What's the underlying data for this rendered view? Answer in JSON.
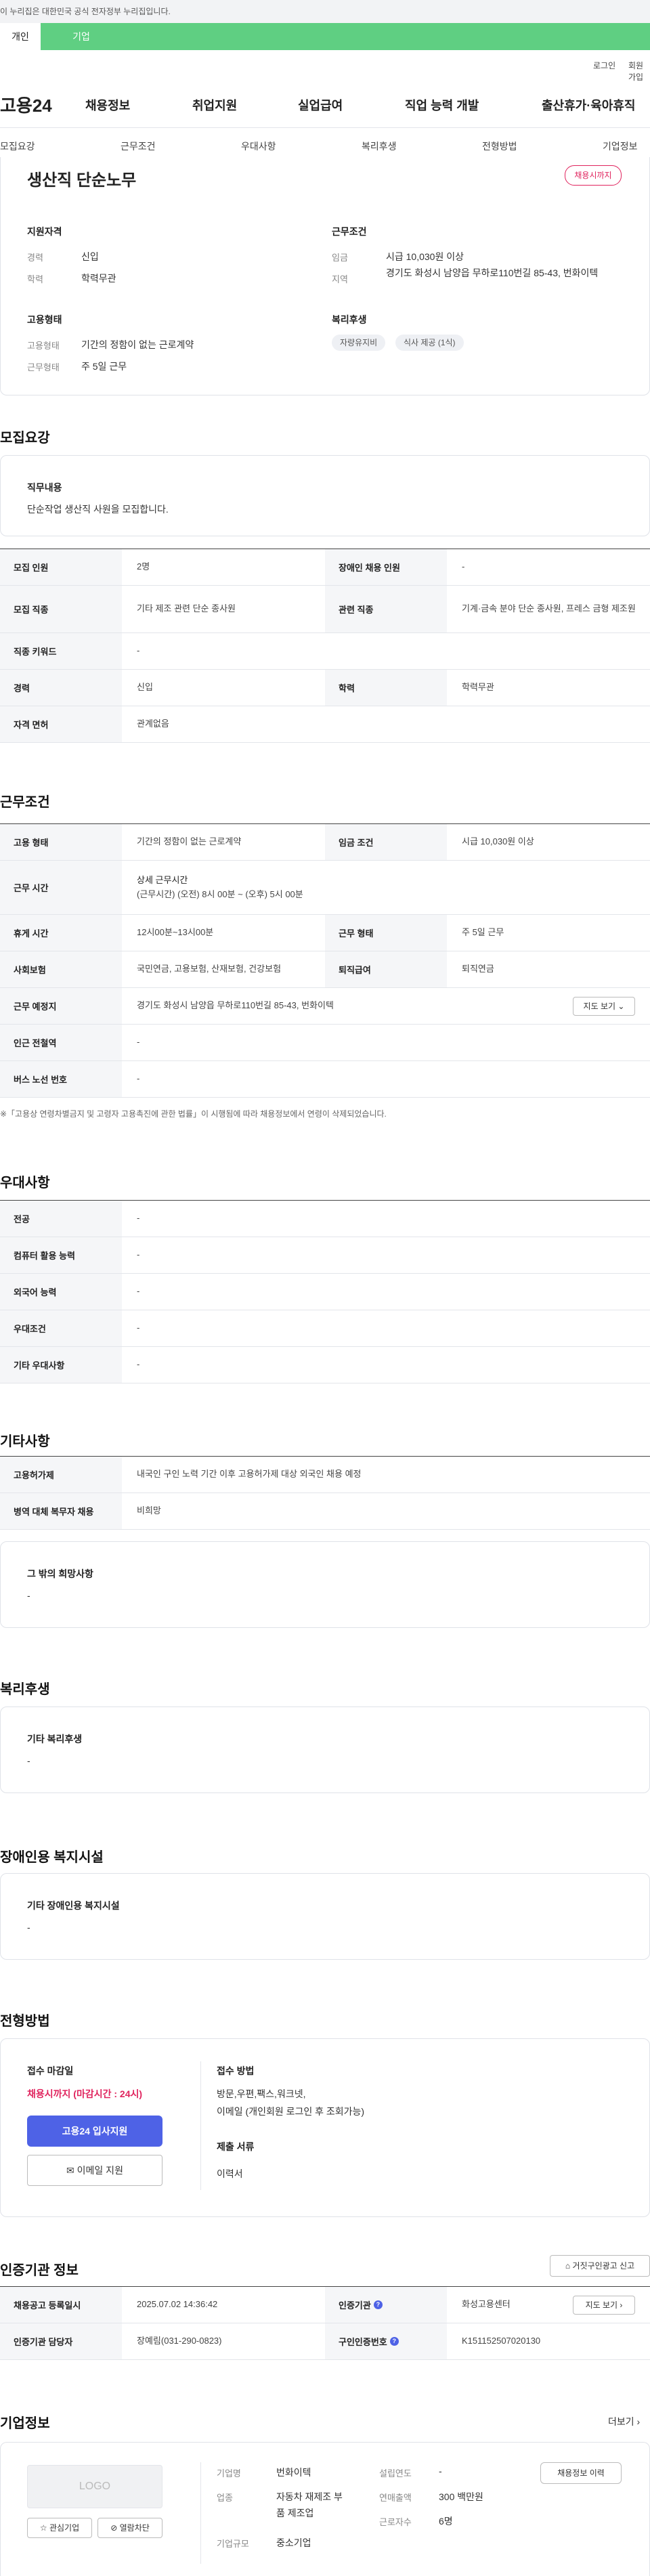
{
  "banner": {
    "text": "이 누리집은 대한민국 공식 전자정부 누리집입니다."
  },
  "tabs": {
    "individual": "개인",
    "company": "기업"
  },
  "util": {
    "login": "로그인",
    "join": "회원가입"
  },
  "logo": "고용24",
  "gnb": [
    "채용정보",
    "취업지원",
    "실업급여",
    "직업 능력 개발",
    "출산휴가·육아휴직"
  ],
  "subnav": [
    "모집요강",
    "근무조건",
    "우대사항",
    "복리후생",
    "전형방법",
    "기업정보"
  ],
  "summary": {
    "title": "생산직 단순노무",
    "badge": "채용시까지",
    "qual_heading": "지원자격",
    "career_label": "경력",
    "career_value": "신입",
    "edu_label": "학력",
    "edu_value": "학력무관",
    "emp_heading": "고용형태",
    "emptype_label": "고용형태",
    "emptype_value": "기간의 정함이 없는 근로계약",
    "worktype_label": "근무형태",
    "worktype_value": "주 5일 근무",
    "cond_heading": "근무조건",
    "wage_label": "임금",
    "wage_value": "시급 10,030원 이상",
    "region_label": "지역",
    "region_value": "경기도 화성시 남양읍 무하로110번길 85-43, 번화이텍",
    "welfare_heading": "복리후생",
    "chips": [
      "자량유지비",
      "식사 제공 (1식)"
    ]
  },
  "recruit": {
    "title": "모집요강",
    "duty_heading": "직무내용",
    "duty_text": "단순작업 생산직 사원을 모집합니다.",
    "rows": [
      {
        "k1": "모집 인원",
        "v1": "2명",
        "k2": "장애인 채용 인원",
        "v2": "-"
      },
      {
        "k1": "모집 직종",
        "v1": "기타 제조 관련 단순 종사원",
        "k2": "관련 직종",
        "v2": "기계·금속 분야 단순 종사원, 프레스 금형 제조원"
      },
      {
        "k1": "직종 키워드",
        "v1": "-"
      },
      {
        "k1": "경력",
        "v1": "신입",
        "k2": "학력",
        "v2": "학력무관"
      },
      {
        "k1": "자격 면허",
        "v1": "관계없음"
      }
    ]
  },
  "work": {
    "title": "근무조건",
    "emptype_k": "고용 형태",
    "emptype_v": "기간의 정함이 없는 근로계약",
    "wage_k": "임금 조건",
    "wage_v": "시급 10,030원 이상",
    "hours_k": "근무 시간",
    "hours_v1": "상세 근무시간",
    "hours_v2": "(근무시간) (오전) 8시 00분 ~ (오후) 5시 00분",
    "break_k": "휴게 시간",
    "break_v": "12시00분~13시00분",
    "form_k": "근무 형태",
    "form_v": "주 5일 근무",
    "ins_k": "사회보험",
    "ins_v": "국민연금, 고용보험, 산재보험, 건강보험",
    "sev_k": "퇴직급여",
    "sev_v": "퇴직연금",
    "place_k": "근무 예정지",
    "place_v": "경기도 화성시 남양읍 무하로110번길 85-43, 번화이텍",
    "map_btn": "지도 보기",
    "subway_k": "인근 전철역",
    "subway_v": "-",
    "bus_k": "버스 노선 번호",
    "bus_v": "-",
    "note": "※「고용상 연령차별금지 및 고령자 고용촉진에 관한 법률」이 시행됨에 따라 채용정보에서 연령이 삭제되었습니다."
  },
  "pref": {
    "title": "우대사항",
    "rows": [
      [
        "전공",
        "-"
      ],
      [
        "컴퓨터 활용 능력",
        "-"
      ],
      [
        "외국어 능력",
        "-"
      ],
      [
        "우대조건",
        "-"
      ],
      [
        "기타 우대사항",
        "-"
      ]
    ]
  },
  "etc": {
    "title": "기타사항",
    "permit_k": "고용허가제",
    "permit_v": "내국인 구인 노력 기간 이후 고용허가제 대상 외국인 채용 예정",
    "mil_k": "병역 대체 복무자 채용",
    "mil_v": "비희망",
    "other_heading": "그 밖의 희망사항",
    "other_v": "-"
  },
  "welfare": {
    "title": "복리후생",
    "heading": "기타 복리후생",
    "value": "-"
  },
  "disabled": {
    "title": "장애인용 복지시설",
    "heading": "기타 장애인용 복지시설",
    "value": "-"
  },
  "process": {
    "title": "전형방법",
    "deadline_heading": "접수 마감일",
    "deadline_value": "채용시까지 (마감시간 : 24시)",
    "apply_btn": "고용24 입사지원",
    "email_btn": "이메일 지원",
    "method_heading": "접수 방법",
    "method_value1": "방문,우편,팩스,워크넷,",
    "method_value2": "이메일 (개인회원 로그인 후 조회가능)",
    "docs_heading": "제출 서류",
    "docs_value": "이력서"
  },
  "cert": {
    "title": "인증기관 정보",
    "report_btn": "거짓구인광고 신고",
    "reg_k": "채용공고 등록일시",
    "reg_v": "2025.07.02 14:36:42",
    "org_k": "인증기관",
    "org_v": "화성고용센터",
    "map_btn": "지도 보기",
    "mgr_k": "인증기관 담당자",
    "mgr_v": "장예림(031-290-0823)",
    "no_k": "구인인증번호",
    "no_v": "K151152507020130"
  },
  "company": {
    "title": "기업정보",
    "more": "더보기",
    "logo_text": "LOGO",
    "fav_btn": "관심기업",
    "block_btn": "열람차단",
    "name_k": "기업명",
    "name_v": "번화이텍",
    "biz_k": "업종",
    "biz_v1": "자동차 재제조 부",
    "biz_v2": "품 제조업",
    "size_k": "기업규모",
    "size_v": "중소기업",
    "est_k": "설립연도",
    "est_v": "-",
    "sales_k": "연매출액",
    "sales_v": "300 백만원",
    "emp_k": "근로자수",
    "emp_v": "6명",
    "history_btn": "채용정보 이력"
  }
}
